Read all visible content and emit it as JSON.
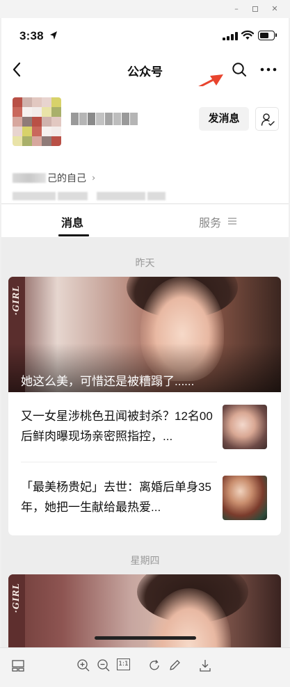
{
  "window": {
    "minimize_glyph": "–",
    "close_glyph": "✕"
  },
  "status_bar": {
    "time": "3:38"
  },
  "nav": {
    "title": "公众号"
  },
  "profile": {
    "follow_button": "发消息",
    "intro_text": "己的自己"
  },
  "tabs": {
    "messages": "消息",
    "services": "服务"
  },
  "feed": {
    "groups": [
      {
        "date": "昨天",
        "cover_tag": "·GIRL",
        "cover_title": "她这么美，可惜还是被糟蹋了......",
        "items": [
          {
            "title": "又一女星涉桃色丑闻被封杀？12名00后鲜肉曝现场亲密照指控，..."
          },
          {
            "title": "「最美杨贵妃」去世：离婚后单身35年，她把一生献给最热爱..."
          }
        ]
      },
      {
        "date": "星期四",
        "cover_tag": "·GIRL"
      }
    ]
  },
  "toolbar": {
    "fit_label": "1:1"
  },
  "colors": {
    "annotation_arrow": "#e8442e",
    "page_background": "#ededed",
    "card_background": "#ffffff"
  }
}
